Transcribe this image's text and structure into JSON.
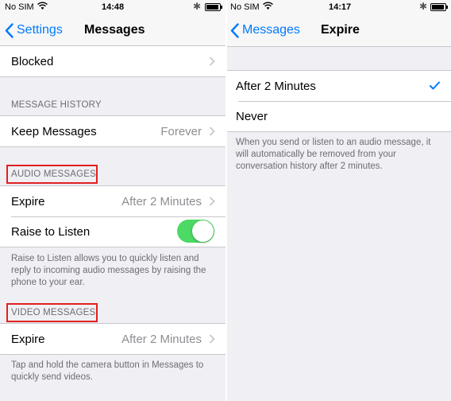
{
  "left": {
    "status": {
      "carrier": "No SIM",
      "time": "14:48"
    },
    "nav": {
      "back_label": "Settings",
      "title": "Messages"
    },
    "blocked_label": "Blocked",
    "message_history": {
      "header": "MESSAGE HISTORY",
      "keep_label": "Keep Messages",
      "keep_value": "Forever"
    },
    "audio": {
      "header": "AUDIO MESSAGES",
      "expire_label": "Expire",
      "expire_value": "After 2 Minutes",
      "raise_label": "Raise to Listen",
      "raise_on": true,
      "footer": "Raise to Listen allows you to quickly listen and reply to incoming audio messages by raising the phone to your ear."
    },
    "video": {
      "header": "VIDEO MESSAGES",
      "expire_label": "Expire",
      "expire_value": "After 2 Minutes",
      "footer": "Tap and hold the camera button in Messages to quickly send videos."
    }
  },
  "right": {
    "status": {
      "carrier": "No SIM",
      "time": "14:17"
    },
    "nav": {
      "back_label": "Messages",
      "title": "Expire"
    },
    "options": [
      {
        "label": "After 2 Minutes",
        "selected": true
      },
      {
        "label": "Never",
        "selected": false
      }
    ],
    "footer": "When you send or listen to an audio message, it will automatically be removed from your conversation history after 2 minutes."
  },
  "colors": {
    "accent": "#007aff",
    "toggle_on": "#4cd964",
    "highlight": "#e02020"
  }
}
